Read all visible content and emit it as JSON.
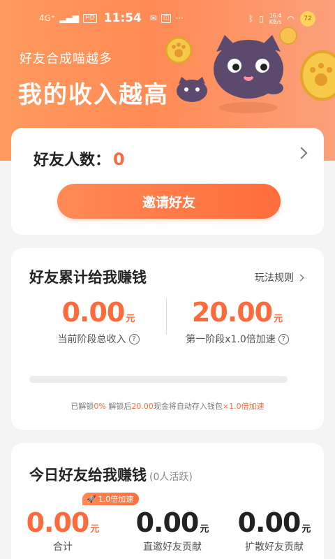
{
  "status_bar": {
    "network": "4G⁺",
    "hd": "HD",
    "time": "11:54",
    "speed_value": "16.4",
    "speed_unit": "KB/s",
    "battery": "72"
  },
  "hero": {
    "subtitle": "好友合成喵越多",
    "title": "我的收入越高"
  },
  "friends_card": {
    "label": "好友人数：",
    "count": "0",
    "invite_button": "邀请好友"
  },
  "earnings_card": {
    "title": "好友累计给我赚钱",
    "rules_link": "玩法规则",
    "stats": [
      {
        "value": "0.00",
        "unit": "元",
        "label": "当前阶段总收入"
      },
      {
        "value": "20.00",
        "unit": "元",
        "label": "第一阶段x1.0倍加速"
      }
    ],
    "progress_fraction": 0,
    "note": {
      "p1": "已解锁",
      "p2": "0%",
      "p3": " 解锁后",
      "p4": "20.00",
      "p5": "现金将自动存入钱包",
      "p6": "×1.0倍加速"
    }
  },
  "today_card": {
    "title": "今日好友给我赚钱",
    "active": "(0人活跃)",
    "boost_tag": "1.0倍加速",
    "stats": [
      {
        "value": "0.00",
        "unit": "元",
        "label": "合计"
      },
      {
        "value": "0.00",
        "unit": "元",
        "label": "直邀好友贡献"
      },
      {
        "value": "0.00",
        "unit": "元",
        "label": "扩散好友贡献"
      }
    ]
  },
  "colors": {
    "accent": "#ff6a3c",
    "hero_gradient_start": "#ff9a5e",
    "hero_gradient_end": "#fba07a"
  }
}
